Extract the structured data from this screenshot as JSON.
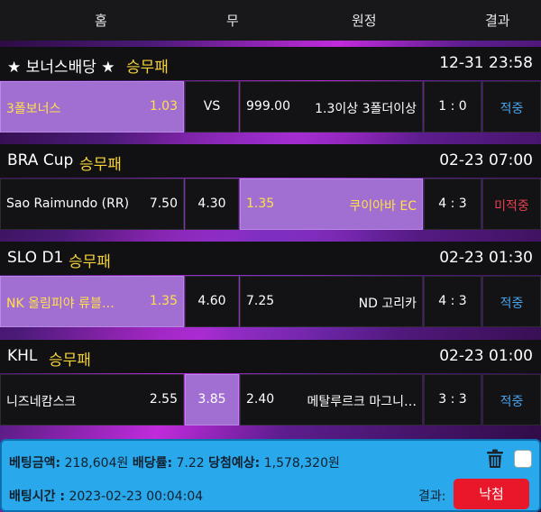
{
  "header": {
    "home": "홈",
    "draw": "무",
    "away": "원정",
    "result": "결과"
  },
  "leagues": [
    {
      "name": "★ 보너스배당 ★",
      "type": "승무패",
      "time": "12-31 23:58"
    },
    {
      "name": "BRA Cup",
      "type": "승무패",
      "time": "02-23 07:00"
    },
    {
      "name": "SLO D1",
      "type": "승무패",
      "time": "02-23 01:30"
    },
    {
      "name": "KHL",
      "type": "승무패",
      "time": "02-23 01:00"
    }
  ],
  "matches": [
    {
      "home": "3폴보너스",
      "home_odds": "1.03",
      "draw": "VS",
      "away_odds": "999.00",
      "away": "1.3이상 3폴더이상",
      "score": "1 : 0",
      "result": "적중",
      "selected": "home"
    },
    {
      "home": "Sao Raimundo (RR)",
      "home_odds": "7.50",
      "draw": "4.30",
      "away_odds": "1.35",
      "away": "쿠이아바 EC",
      "score": "4 : 3",
      "result": "미적중",
      "selected": "away"
    },
    {
      "home": "NK 올림피야 류블…",
      "home_odds": "1.35",
      "draw": "4.60",
      "away_odds": "7.25",
      "away": "ND 고리카",
      "score": "4 : 3",
      "result": "적중",
      "selected": "home"
    },
    {
      "home": "니즈네캄스크",
      "home_odds": "2.55",
      "draw": "3.85",
      "away_odds": "2.40",
      "away": "메탈루르크 마그니…",
      "score": "3 : 3",
      "result": "적중",
      "selected": "draw"
    }
  ],
  "footer": {
    "bet_amount_label": "베팅금액:",
    "bet_amount": "218,604원",
    "odds_label": "배당률:",
    "odds": "7.22",
    "expected_label": "당첨예상:",
    "expected": "1,578,320원",
    "bet_time_label": "배팅시간 :",
    "bet_time": "2023-02-23 00:04:04",
    "result_label": "결과:",
    "result_button": "낙첨"
  },
  "colors": {
    "hit": "#4aa3e8",
    "miss": "#e8404f",
    "selected_bg": "#a16fd2",
    "selected_text": "#ffe04a",
    "league_type": "#f3d23b",
    "footer_bg": "#2aa8ec",
    "lose_button": "#e8182a"
  },
  "icons": {
    "delete": "trash-icon",
    "select": "checkbox"
  }
}
